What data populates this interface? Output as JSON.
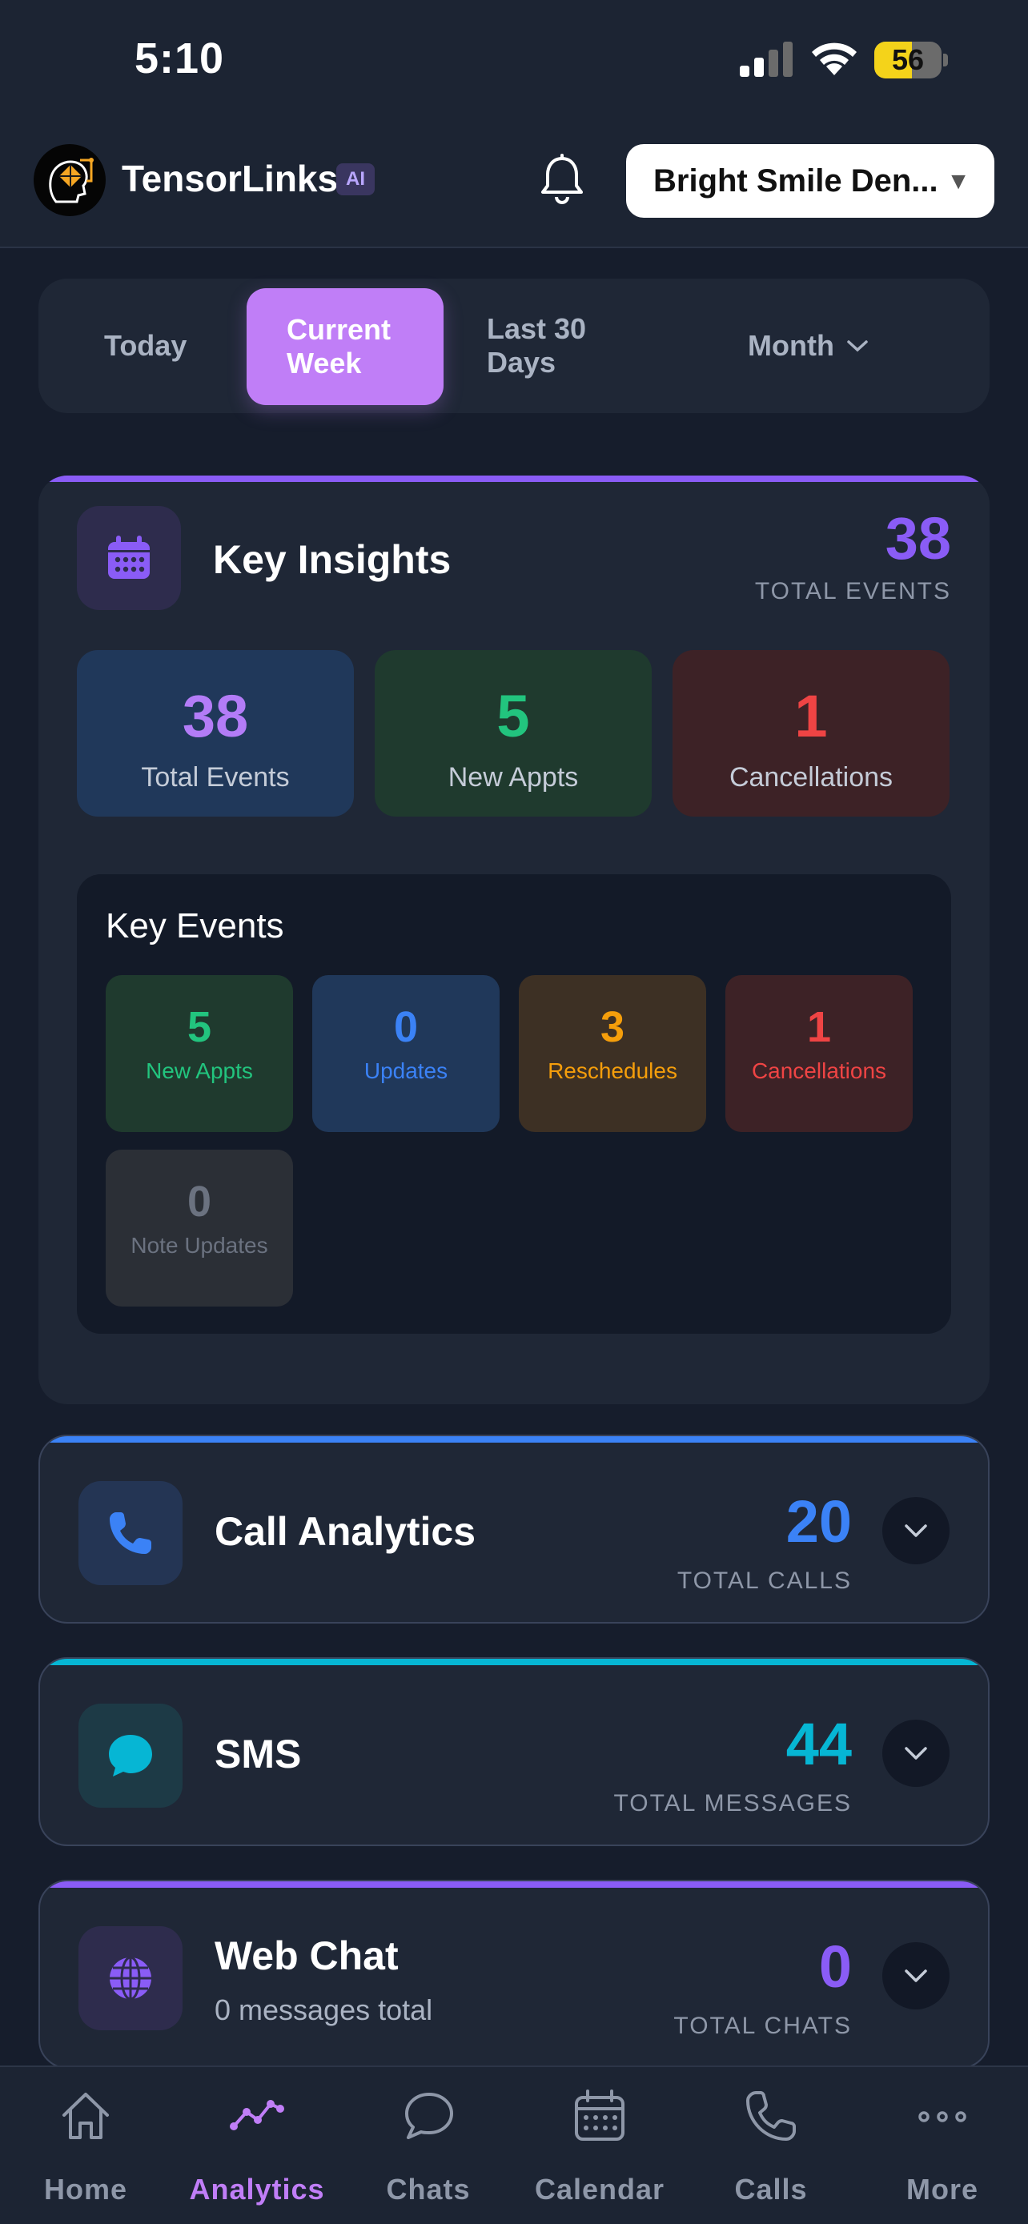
{
  "status_bar": {
    "time": "5:10",
    "battery": "56",
    "battery_level_percent": 56
  },
  "header": {
    "brand": "TensorLinks",
    "badge": "AI",
    "practice_selector": "Bright Smile Den...",
    "caret": "▼"
  },
  "tabs": {
    "today": "Today",
    "current_week": "Current Week",
    "last_30_days": "Last 30 Days",
    "month": "Month",
    "active": "current_week"
  },
  "insights": {
    "title": "Key Insights",
    "total": "38",
    "total_label": "TOTAL EVENTS",
    "tiles": [
      {
        "value": "38",
        "label": "Total Events",
        "color": "#b37cf7",
        "bg": "#20385a"
      },
      {
        "value": "5",
        "label": "New Appts",
        "color": "#22c47e",
        "bg": "#1f3a2e"
      },
      {
        "value": "1",
        "label": "Cancellations",
        "color": "#ef4444",
        "bg": "#3d2226"
      }
    ],
    "key_events": {
      "title": "Key Events",
      "tiles": [
        {
          "value": "5",
          "label": "New Appts",
          "color": "#22c47e",
          "bg": "#1f3a2e"
        },
        {
          "value": "0",
          "label": "Updates",
          "color": "#3b82f6",
          "bg": "#20385a"
        },
        {
          "value": "3",
          "label": "Reschedules",
          "color": "#f59e0b",
          "bg": "#3d3024"
        },
        {
          "value": "1",
          "label": "Cancellations",
          "color": "#ef4444",
          "bg": "#3d2226"
        },
        {
          "value": "0",
          "label": "Note Updates",
          "color": "#6b7280",
          "bg": "#2b2f36"
        }
      ]
    }
  },
  "call_analytics": {
    "title": "Call Analytics",
    "total": "20",
    "total_label": "TOTAL CALLS",
    "accent": "#3b82f6"
  },
  "sms": {
    "title": "SMS",
    "total": "44",
    "total_label": "TOTAL MESSAGES",
    "accent": "#06b6d4"
  },
  "web_chat": {
    "title": "Web Chat",
    "subtitle": "0 messages total",
    "total": "0",
    "total_label": "TOTAL CHATS",
    "accent": "#8a5cf6"
  },
  "bottom_nav": {
    "home": "Home",
    "analytics": "Analytics",
    "chats": "Chats",
    "calendar": "Calendar",
    "calls": "Calls",
    "more": "More",
    "active": "analytics"
  }
}
